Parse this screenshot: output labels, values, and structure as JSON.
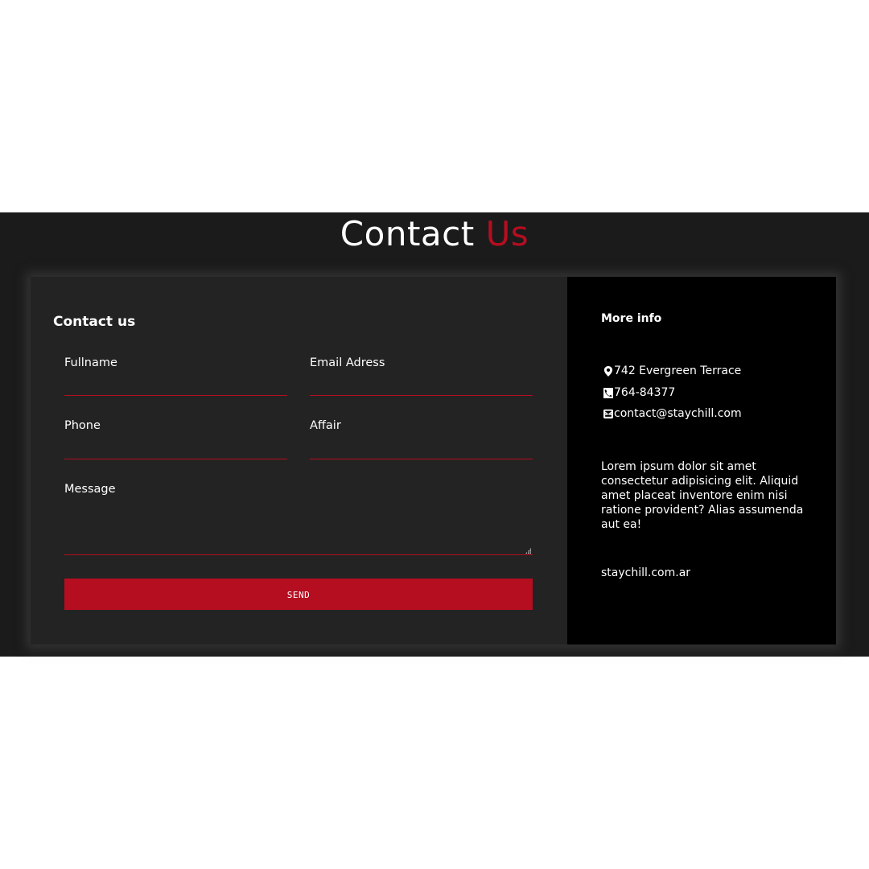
{
  "page": {
    "title_main": "Contact",
    "title_accent": "Us"
  },
  "form": {
    "title": "Contact us",
    "fields": {
      "fullname": {
        "label": "Fullname",
        "value": ""
      },
      "email": {
        "label": "Email Adress",
        "value": ""
      },
      "phone": {
        "label": "Phone",
        "value": ""
      },
      "affair": {
        "label": "Affair",
        "value": ""
      },
      "message": {
        "label": "Message",
        "value": ""
      }
    },
    "send_label": "SEND"
  },
  "info": {
    "title": "More info",
    "address": "742 Evergreen Terrace",
    "phone": "764-84377",
    "email": "contact@staychill.com",
    "description": "Lorem ipsum dolor sit amet consectetur adipisicing elit. Aliquid amet placeat inventore enim nisi ratione provident? Alias assumenda aut ea!",
    "website": "staychill.com.ar",
    "icons": [
      "map-marker-icon",
      "phone-icon",
      "envelope-icon"
    ]
  },
  "colors": {
    "accent": "#b50e20",
    "section_bg": "#1b1b1b",
    "form_bg": "#232323",
    "info_bg": "#000000"
  }
}
